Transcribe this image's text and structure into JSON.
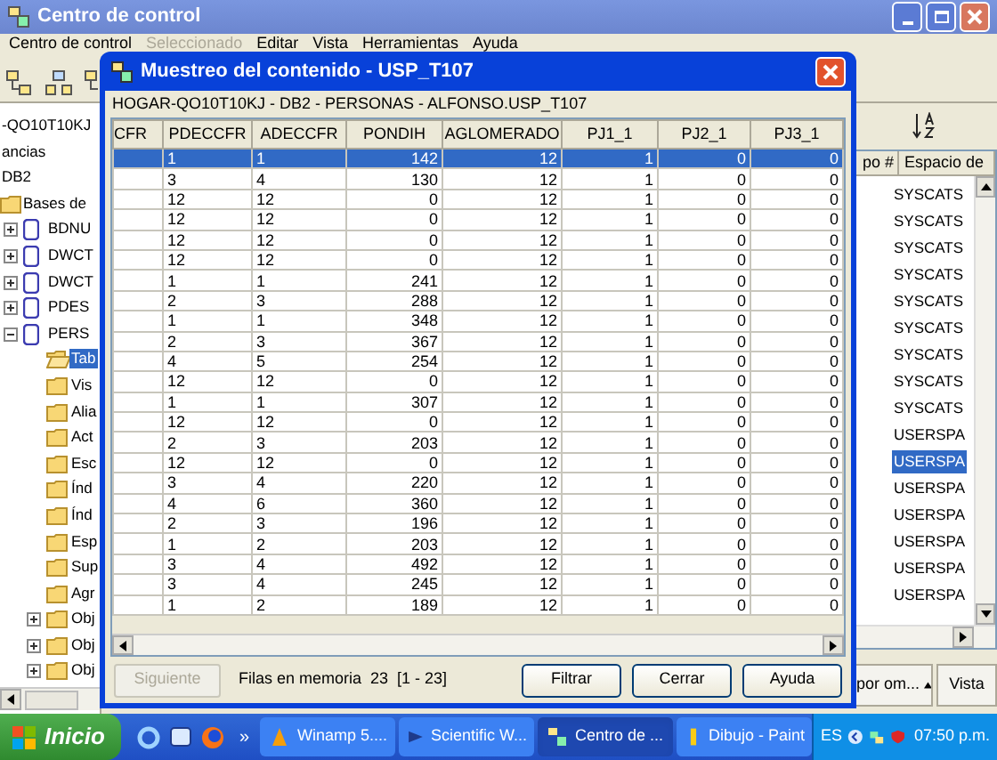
{
  "main_window": {
    "title": "Centro de control",
    "menu": [
      {
        "label": "Centro de control",
        "disabled": false
      },
      {
        "label": "Seleccionado",
        "disabled": true
      },
      {
        "label": "Editar",
        "disabled": false
      },
      {
        "label": "Vista",
        "disabled": false
      },
      {
        "label": "Herramientas",
        "disabled": false
      },
      {
        "label": "Ayuda",
        "disabled": false
      }
    ],
    "tree": [
      {
        "label": "-QO10T10KJ"
      },
      {
        "label": "ancias"
      },
      {
        "label": "DB2"
      },
      {
        "label": "Bases de",
        "kind": "folder",
        "children": [
          {
            "label": "BDNU",
            "kind": "database",
            "expanded": false
          },
          {
            "label": "DWCT",
            "kind": "database",
            "expanded": false
          },
          {
            "label": "DWCT",
            "kind": "database",
            "expanded": false
          },
          {
            "label": "PDES",
            "kind": "database",
            "expanded": false
          },
          {
            "label": "PERS",
            "kind": "database",
            "expanded": true,
            "children": [
              {
                "label": "Tab",
                "kind": "open-folder",
                "selected": true
              },
              {
                "label": "Vis",
                "kind": "folder",
                "selected": false
              },
              {
                "label": "Alia",
                "kind": "folder",
                "selected": false
              },
              {
                "label": "Act",
                "kind": "folder",
                "selected": false
              },
              {
                "label": "Esc",
                "kind": "folder",
                "selected": false
              },
              {
                "label": "Índ",
                "kind": "folder",
                "selected": false
              },
              {
                "label": "Índ",
                "kind": "folder",
                "selected": false
              },
              {
                "label": "Esp",
                "kind": "folder",
                "selected": false
              },
              {
                "label": "Sup",
                "kind": "folder",
                "selected": false
              },
              {
                "label": "Agr",
                "kind": "folder",
                "selected": false
              },
              {
                "label": "Obj",
                "kind": "folder",
                "selected": false,
                "expanded": false
              },
              {
                "label": "Obj",
                "kind": "folder",
                "selected": false,
                "expanded": false
              },
              {
                "label": "Obj",
                "kind": "folder",
                "selected": false,
                "expanded": false
              }
            ]
          }
        ]
      }
    ],
    "list": {
      "columns": [
        "po #",
        "Espacio de"
      ],
      "items": [
        {
          "label": "SYSCATS",
          "selected": false
        },
        {
          "label": "SYSCATS",
          "selected": false
        },
        {
          "label": "SYSCATS",
          "selected": false
        },
        {
          "label": "SYSCATS",
          "selected": false
        },
        {
          "label": "SYSCATS",
          "selected": false
        },
        {
          "label": "SYSCATS",
          "selected": false
        },
        {
          "label": "SYSCATS",
          "selected": false
        },
        {
          "label": "SYSCATS",
          "selected": false
        },
        {
          "label": "SYSCATS",
          "selected": false
        },
        {
          "label": "USERSPA",
          "selected": false
        },
        {
          "label": "USERSPA",
          "selected": true
        },
        {
          "label": "USERSPA",
          "selected": false
        },
        {
          "label": "USERSPA",
          "selected": false
        },
        {
          "label": "USERSPA",
          "selected": false
        },
        {
          "label": "USERSPA",
          "selected": false
        },
        {
          "label": "USERSPA",
          "selected": false
        }
      ]
    },
    "view_dropdown": "por om...",
    "view_button": "Vista"
  },
  "dialog": {
    "title": "Muestreo del contenido - USP_T107",
    "path": "HOGAR-QO10T10KJ - DB2 - PERSONAS - ALFONSO.USP_T107",
    "columns": [
      "CFR",
      "PDECCFR",
      "ADECCFR",
      "PONDIH",
      "AGLOMERADO",
      "PJ1_1",
      "PJ2_1",
      "PJ3_1"
    ],
    "rows": [
      {
        "cells": [
          "",
          "1",
          "1",
          "142",
          "12",
          "1",
          "0",
          "0"
        ],
        "selected": true
      },
      {
        "cells": [
          "",
          "3",
          "4",
          "130",
          "12",
          "1",
          "0",
          "0"
        ],
        "selected": false
      },
      {
        "cells": [
          "",
          "12",
          "12",
          "0",
          "12",
          "1",
          "0",
          "0"
        ],
        "selected": false
      },
      {
        "cells": [
          "",
          "12",
          "12",
          "0",
          "12",
          "1",
          "0",
          "0"
        ],
        "selected": false
      },
      {
        "cells": [
          "",
          "12",
          "12",
          "0",
          "12",
          "1",
          "0",
          "0"
        ],
        "selected": false
      },
      {
        "cells": [
          "",
          "12",
          "12",
          "0",
          "12",
          "1",
          "0",
          "0"
        ],
        "selected": false
      },
      {
        "cells": [
          "",
          "1",
          "1",
          "241",
          "12",
          "1",
          "0",
          "0"
        ],
        "selected": false
      },
      {
        "cells": [
          "",
          "2",
          "3",
          "288",
          "12",
          "1",
          "0",
          "0"
        ],
        "selected": false
      },
      {
        "cells": [
          "",
          "1",
          "1",
          "348",
          "12",
          "1",
          "0",
          "0"
        ],
        "selected": false
      },
      {
        "cells": [
          "",
          "2",
          "3",
          "367",
          "12",
          "1",
          "0",
          "0"
        ],
        "selected": false
      },
      {
        "cells": [
          "",
          "4",
          "5",
          "254",
          "12",
          "1",
          "0",
          "0"
        ],
        "selected": false
      },
      {
        "cells": [
          "",
          "12",
          "12",
          "0",
          "12",
          "1",
          "0",
          "0"
        ],
        "selected": false
      },
      {
        "cells": [
          "",
          "1",
          "1",
          "307",
          "12",
          "1",
          "0",
          "0"
        ],
        "selected": false
      },
      {
        "cells": [
          "",
          "12",
          "12",
          "0",
          "12",
          "1",
          "0",
          "0"
        ],
        "selected": false
      },
      {
        "cells": [
          "",
          "2",
          "3",
          "203",
          "12",
          "1",
          "0",
          "0"
        ],
        "selected": false
      },
      {
        "cells": [
          "",
          "12",
          "12",
          "0",
          "12",
          "1",
          "0",
          "0"
        ],
        "selected": false
      },
      {
        "cells": [
          "",
          "3",
          "4",
          "220",
          "12",
          "1",
          "0",
          "0"
        ],
        "selected": false
      },
      {
        "cells": [
          "",
          "4",
          "6",
          "360",
          "12",
          "1",
          "0",
          "0"
        ],
        "selected": false
      },
      {
        "cells": [
          "",
          "2",
          "3",
          "196",
          "12",
          "1",
          "0",
          "0"
        ],
        "selected": false
      },
      {
        "cells": [
          "",
          "1",
          "2",
          "203",
          "12",
          "1",
          "0",
          "0"
        ],
        "selected": false
      },
      {
        "cells": [
          "",
          "3",
          "4",
          "492",
          "12",
          "1",
          "0",
          "0"
        ],
        "selected": false
      },
      {
        "cells": [
          "",
          "3",
          "4",
          "245",
          "12",
          "1",
          "0",
          "0"
        ],
        "selected": false
      },
      {
        "cells": [
          "",
          "1",
          "2",
          "189",
          "12",
          "1",
          "0",
          "0"
        ],
        "selected": false
      }
    ],
    "next_button": {
      "label": "Siguiente",
      "disabled": true
    },
    "status": "Filas en memoria  23  [1 - 23]",
    "buttons": [
      "Filtrar",
      "Cerrar",
      "Ayuda"
    ]
  },
  "taskbar": {
    "start": "Inicio",
    "more": "»",
    "tasks": [
      {
        "label": "Winamp 5....",
        "selected": false
      },
      {
        "label": "Scientific W...",
        "selected": false
      },
      {
        "label": "Centro de ...",
        "selected": true
      },
      {
        "label": "Dibujo - Paint",
        "selected": false
      }
    ],
    "language": "ES",
    "clock": "07:50 p.m."
  }
}
